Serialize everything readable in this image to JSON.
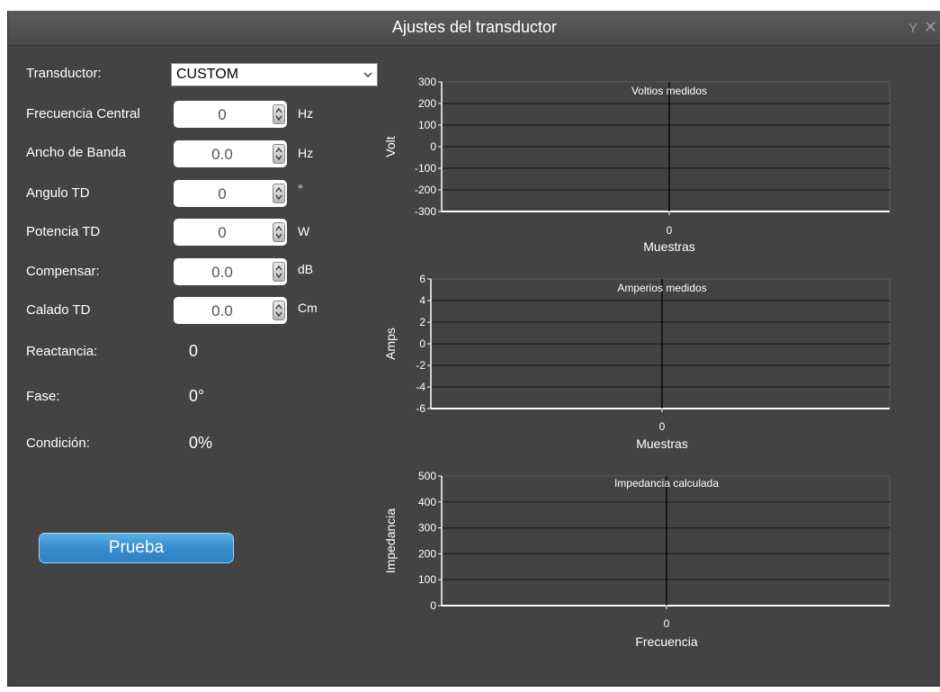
{
  "window": {
    "title": "Ajustes del transductor"
  },
  "form": {
    "transductor_label": "Transductor:",
    "transductor_value": "CUSTOM",
    "rows": [
      {
        "label": "Frecuencia Central",
        "value": "0",
        "unit": "Hz"
      },
      {
        "label": "Ancho de Banda",
        "value": "0.0",
        "unit": "Hz"
      },
      {
        "label": "Angulo TD",
        "value": "0",
        "unit": "°"
      },
      {
        "label": "Potencia TD",
        "value": "0",
        "unit": "W"
      },
      {
        "label": "Compensar:",
        "value": "0.0",
        "unit": "dB"
      },
      {
        "label": "Calado TD",
        "value": "0.0",
        "unit": "Cm"
      }
    ],
    "readouts": [
      {
        "label": "Reactancia:",
        "value": "0"
      },
      {
        "label": "Fase:",
        "value": "0°"
      },
      {
        "label": "Condición:",
        "value": "0%"
      }
    ]
  },
  "test_button": {
    "label": "Prueba"
  },
  "colors": {
    "window_bg": "#434343",
    "titlebar": "#4f4f4f",
    "accent": "#3a8fcf"
  },
  "chart_data": [
    {
      "type": "line",
      "title": "Voltios medidos",
      "ylabel": "Volt",
      "xlabel": "Muestras",
      "ylim": [
        -300,
        300
      ],
      "yticks": [
        300,
        200,
        100,
        0,
        -100,
        -200,
        -300
      ],
      "x_ticks": [
        0
      ],
      "grid": true,
      "series": [
        {
          "x": [
            0
          ],
          "y": [
            0
          ]
        }
      ]
    },
    {
      "type": "line",
      "title": "Amperios medidos",
      "ylabel": "Amps",
      "xlabel": "Muestras",
      "ylim": [
        -6,
        6
      ],
      "yticks": [
        6,
        4,
        2,
        0,
        -2,
        -4,
        -6
      ],
      "x_ticks": [
        0
      ],
      "grid": true,
      "series": [
        {
          "x": [
            0
          ],
          "y": [
            0
          ]
        }
      ]
    },
    {
      "type": "line",
      "title": "Impedancia calculada",
      "ylabel": "Impedancia",
      "xlabel": "Frecuencia",
      "ylim": [
        0,
        500
      ],
      "yticks": [
        500,
        400,
        300,
        200,
        100,
        0
      ],
      "x_ticks": [
        0
      ],
      "grid": true,
      "series": [
        {
          "x": [
            0
          ],
          "y": [
            0
          ]
        }
      ]
    }
  ]
}
